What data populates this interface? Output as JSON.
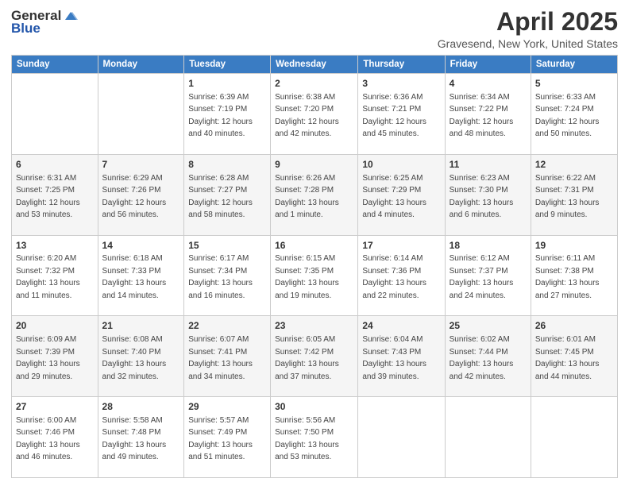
{
  "header": {
    "logo_general": "General",
    "logo_blue": "Blue",
    "main_title": "April 2025",
    "subtitle": "Gravesend, New York, United States"
  },
  "weekdays": [
    "Sunday",
    "Monday",
    "Tuesday",
    "Wednesday",
    "Thursday",
    "Friday",
    "Saturday"
  ],
  "weeks": [
    [
      {
        "day": "",
        "sunrise": "",
        "sunset": "",
        "daylight": ""
      },
      {
        "day": "",
        "sunrise": "",
        "sunset": "",
        "daylight": ""
      },
      {
        "day": "1",
        "sunrise": "Sunrise: 6:39 AM",
        "sunset": "Sunset: 7:19 PM",
        "daylight": "Daylight: 12 hours and 40 minutes."
      },
      {
        "day": "2",
        "sunrise": "Sunrise: 6:38 AM",
        "sunset": "Sunset: 7:20 PM",
        "daylight": "Daylight: 12 hours and 42 minutes."
      },
      {
        "day": "3",
        "sunrise": "Sunrise: 6:36 AM",
        "sunset": "Sunset: 7:21 PM",
        "daylight": "Daylight: 12 hours and 45 minutes."
      },
      {
        "day": "4",
        "sunrise": "Sunrise: 6:34 AM",
        "sunset": "Sunset: 7:22 PM",
        "daylight": "Daylight: 12 hours and 48 minutes."
      },
      {
        "day": "5",
        "sunrise": "Sunrise: 6:33 AM",
        "sunset": "Sunset: 7:24 PM",
        "daylight": "Daylight: 12 hours and 50 minutes."
      }
    ],
    [
      {
        "day": "6",
        "sunrise": "Sunrise: 6:31 AM",
        "sunset": "Sunset: 7:25 PM",
        "daylight": "Daylight: 12 hours and 53 minutes."
      },
      {
        "day": "7",
        "sunrise": "Sunrise: 6:29 AM",
        "sunset": "Sunset: 7:26 PM",
        "daylight": "Daylight: 12 hours and 56 minutes."
      },
      {
        "day": "8",
        "sunrise": "Sunrise: 6:28 AM",
        "sunset": "Sunset: 7:27 PM",
        "daylight": "Daylight: 12 hours and 58 minutes."
      },
      {
        "day": "9",
        "sunrise": "Sunrise: 6:26 AM",
        "sunset": "Sunset: 7:28 PM",
        "daylight": "Daylight: 13 hours and 1 minute."
      },
      {
        "day": "10",
        "sunrise": "Sunrise: 6:25 AM",
        "sunset": "Sunset: 7:29 PM",
        "daylight": "Daylight: 13 hours and 4 minutes."
      },
      {
        "day": "11",
        "sunrise": "Sunrise: 6:23 AM",
        "sunset": "Sunset: 7:30 PM",
        "daylight": "Daylight: 13 hours and 6 minutes."
      },
      {
        "day": "12",
        "sunrise": "Sunrise: 6:22 AM",
        "sunset": "Sunset: 7:31 PM",
        "daylight": "Daylight: 13 hours and 9 minutes."
      }
    ],
    [
      {
        "day": "13",
        "sunrise": "Sunrise: 6:20 AM",
        "sunset": "Sunset: 7:32 PM",
        "daylight": "Daylight: 13 hours and 11 minutes."
      },
      {
        "day": "14",
        "sunrise": "Sunrise: 6:18 AM",
        "sunset": "Sunset: 7:33 PM",
        "daylight": "Daylight: 13 hours and 14 minutes."
      },
      {
        "day": "15",
        "sunrise": "Sunrise: 6:17 AM",
        "sunset": "Sunset: 7:34 PM",
        "daylight": "Daylight: 13 hours and 16 minutes."
      },
      {
        "day": "16",
        "sunrise": "Sunrise: 6:15 AM",
        "sunset": "Sunset: 7:35 PM",
        "daylight": "Daylight: 13 hours and 19 minutes."
      },
      {
        "day": "17",
        "sunrise": "Sunrise: 6:14 AM",
        "sunset": "Sunset: 7:36 PM",
        "daylight": "Daylight: 13 hours and 22 minutes."
      },
      {
        "day": "18",
        "sunrise": "Sunrise: 6:12 AM",
        "sunset": "Sunset: 7:37 PM",
        "daylight": "Daylight: 13 hours and 24 minutes."
      },
      {
        "day": "19",
        "sunrise": "Sunrise: 6:11 AM",
        "sunset": "Sunset: 7:38 PM",
        "daylight": "Daylight: 13 hours and 27 minutes."
      }
    ],
    [
      {
        "day": "20",
        "sunrise": "Sunrise: 6:09 AM",
        "sunset": "Sunset: 7:39 PM",
        "daylight": "Daylight: 13 hours and 29 minutes."
      },
      {
        "day": "21",
        "sunrise": "Sunrise: 6:08 AM",
        "sunset": "Sunset: 7:40 PM",
        "daylight": "Daylight: 13 hours and 32 minutes."
      },
      {
        "day": "22",
        "sunrise": "Sunrise: 6:07 AM",
        "sunset": "Sunset: 7:41 PM",
        "daylight": "Daylight: 13 hours and 34 minutes."
      },
      {
        "day": "23",
        "sunrise": "Sunrise: 6:05 AM",
        "sunset": "Sunset: 7:42 PM",
        "daylight": "Daylight: 13 hours and 37 minutes."
      },
      {
        "day": "24",
        "sunrise": "Sunrise: 6:04 AM",
        "sunset": "Sunset: 7:43 PM",
        "daylight": "Daylight: 13 hours and 39 minutes."
      },
      {
        "day": "25",
        "sunrise": "Sunrise: 6:02 AM",
        "sunset": "Sunset: 7:44 PM",
        "daylight": "Daylight: 13 hours and 42 minutes."
      },
      {
        "day": "26",
        "sunrise": "Sunrise: 6:01 AM",
        "sunset": "Sunset: 7:45 PM",
        "daylight": "Daylight: 13 hours and 44 minutes."
      }
    ],
    [
      {
        "day": "27",
        "sunrise": "Sunrise: 6:00 AM",
        "sunset": "Sunset: 7:46 PM",
        "daylight": "Daylight: 13 hours and 46 minutes."
      },
      {
        "day": "28",
        "sunrise": "Sunrise: 5:58 AM",
        "sunset": "Sunset: 7:48 PM",
        "daylight": "Daylight: 13 hours and 49 minutes."
      },
      {
        "day": "29",
        "sunrise": "Sunrise: 5:57 AM",
        "sunset": "Sunset: 7:49 PM",
        "daylight": "Daylight: 13 hours and 51 minutes."
      },
      {
        "day": "30",
        "sunrise": "Sunrise: 5:56 AM",
        "sunset": "Sunset: 7:50 PM",
        "daylight": "Daylight: 13 hours and 53 minutes."
      },
      {
        "day": "",
        "sunrise": "",
        "sunset": "",
        "daylight": ""
      },
      {
        "day": "",
        "sunrise": "",
        "sunset": "",
        "daylight": ""
      },
      {
        "day": "",
        "sunrise": "",
        "sunset": "",
        "daylight": ""
      }
    ]
  ]
}
